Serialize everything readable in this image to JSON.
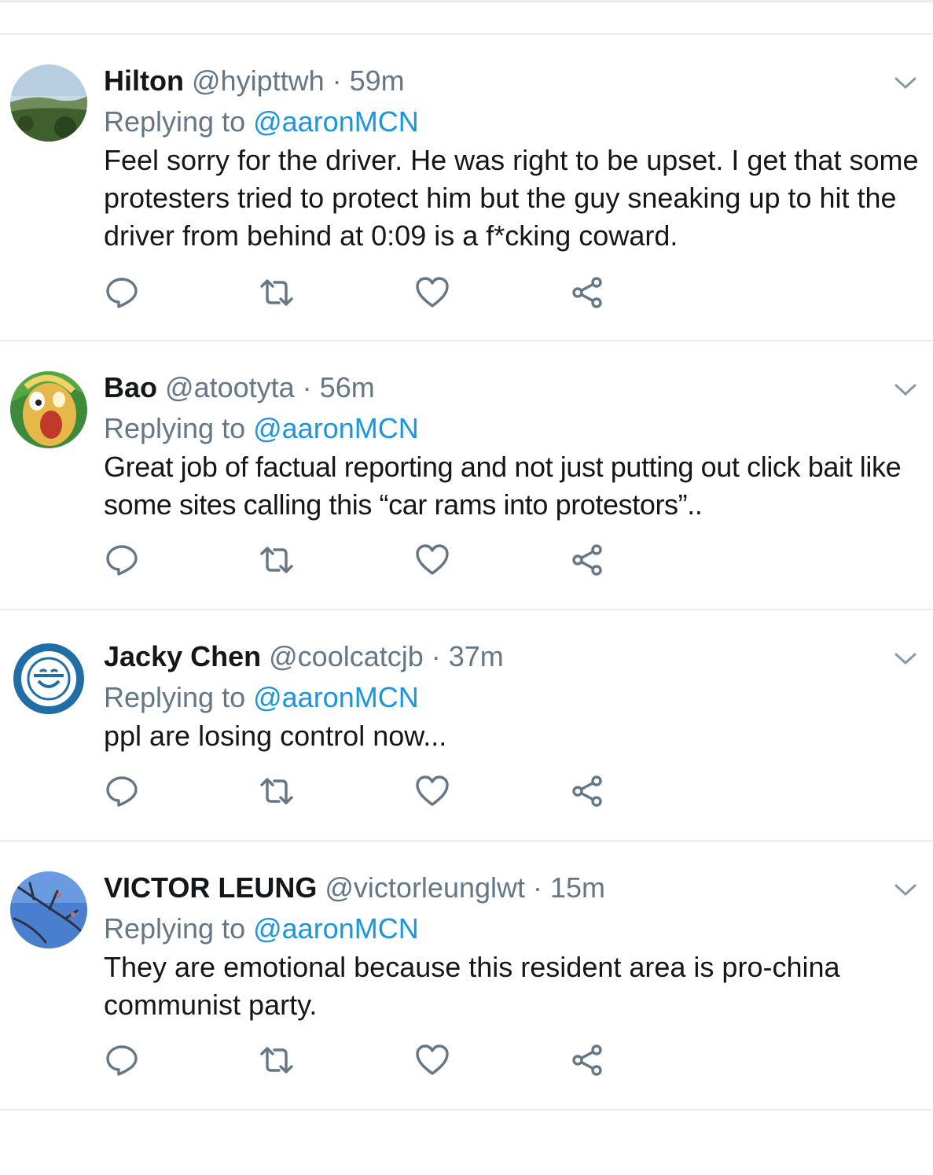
{
  "colors": {
    "name": "#14171a",
    "meta": "#657786",
    "mention": "#1b95e0",
    "separator": "#e6ecf0"
  },
  "icons": {
    "reply": "reply-icon",
    "retweet": "retweet-icon",
    "like": "like-icon",
    "share": "share-icon",
    "more": "chevron-down-icon"
  },
  "tweets": [
    {
      "name": "Hilton",
      "handle": "@hyipttwh",
      "sep": " · ",
      "time": "59m",
      "replying_prefix": "Replying to ",
      "replying_to": "@aaronMCN",
      "text": "Feel sorry for the driver. He was right to be upset. I get that some protesters tried to protect him but the guy sneaking up to hit the driver from behind at 0:09 is a f*cking coward."
    },
    {
      "name": "Bao",
      "handle": "@atootyta",
      "sep": " · ",
      "time": "56m",
      "replying_prefix": "Replying to ",
      "replying_to": "@aaronMCN",
      "text": "Great job of factual reporting and not just putting out click bait like some sites calling this “car rams into protestors”.."
    },
    {
      "name": "Jacky Chen",
      "handle": "@coolcatcjb",
      "sep": " · ",
      "time": "37m",
      "replying_prefix": "Replying to ",
      "replying_to": "@aaronMCN",
      "text": "ppl are losing control now..."
    },
    {
      "name": "VICTOR LEUNG",
      "handle": "@victorleunglwt",
      "sep": " · ",
      "time": "15m",
      "replying_prefix": "Replying to ",
      "replying_to": "@aaronMCN",
      "text": "They are emotional because this resident area is pro-china communist party."
    }
  ]
}
